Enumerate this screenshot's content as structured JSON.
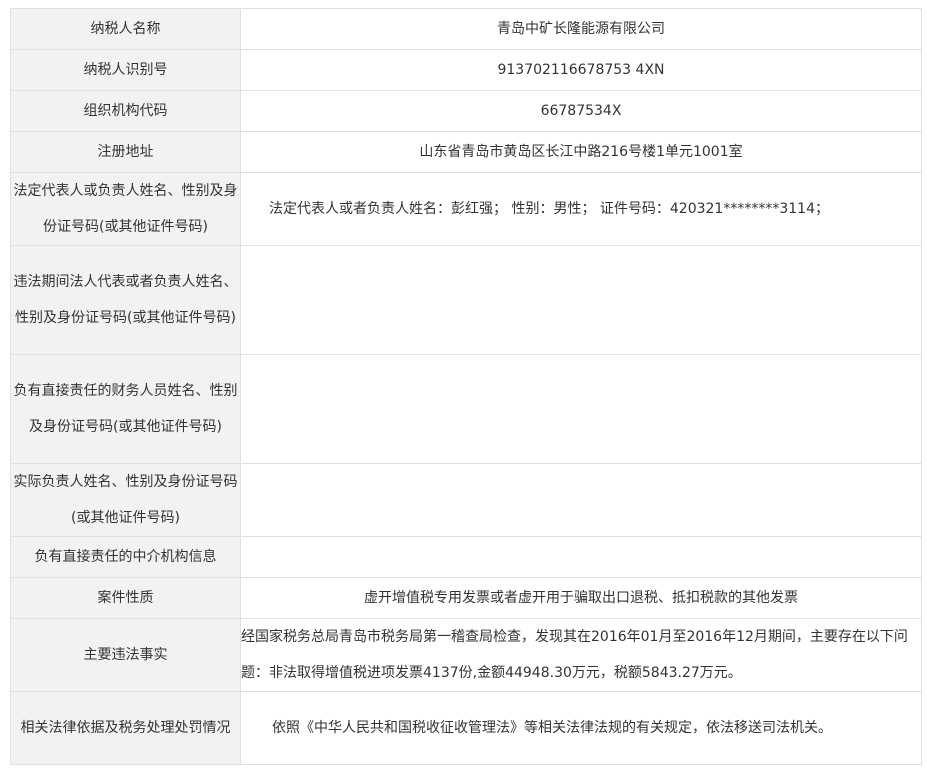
{
  "rows": [
    {
      "label": "纳税人名称",
      "value": "青岛中矿长隆能源有限公司"
    },
    {
      "label": "纳税人识别号",
      "value": "913702116678753 4XN"
    },
    {
      "label": "组织机构代码",
      "value": "66787534X"
    },
    {
      "label": "注册地址",
      "value": "山东省青岛市黄岛区长江中路216号楼1单元1001室"
    },
    {
      "label": "法定代表人或负责人姓名、性别及身份证号码(或其他证件号码)",
      "value": "法定代表人或者负责人姓名：彭红强； 性别：男性； 证件号码：420321********3114；"
    },
    {
      "label": "违法期间法人代表或者负责人姓名、性别及身份证号码(或其他证件号码)",
      "value": ""
    },
    {
      "label": "负有直接责任的财务人员姓名、性别及身份证号码(或其他证件号码)",
      "value": ""
    },
    {
      "label": "实际负责人姓名、性别及身份证号码(或其他证件号码)",
      "value": ""
    },
    {
      "label": "负有直接责任的中介机构信息",
      "value": ""
    },
    {
      "label": "案件性质",
      "value": "虚开增值税专用发票或者虚开用于骗取出口退税、抵扣税款的其他发票"
    },
    {
      "label": "主要违法事实",
      "value": "经国家税务总局青岛市税务局第一稽查局检查，发现其在2016年01月至2016年12月期间，主要存在以下问题：非法取得增值税进项发票4137份,金额44948.30万元，税额5843.27万元。"
    },
    {
      "label": "相关法律依据及税务处理处罚情况",
      "value": "依照《中华人民共和国税收征收管理法》等相关法律法规的有关规定，依法移送司法机关。"
    }
  ]
}
